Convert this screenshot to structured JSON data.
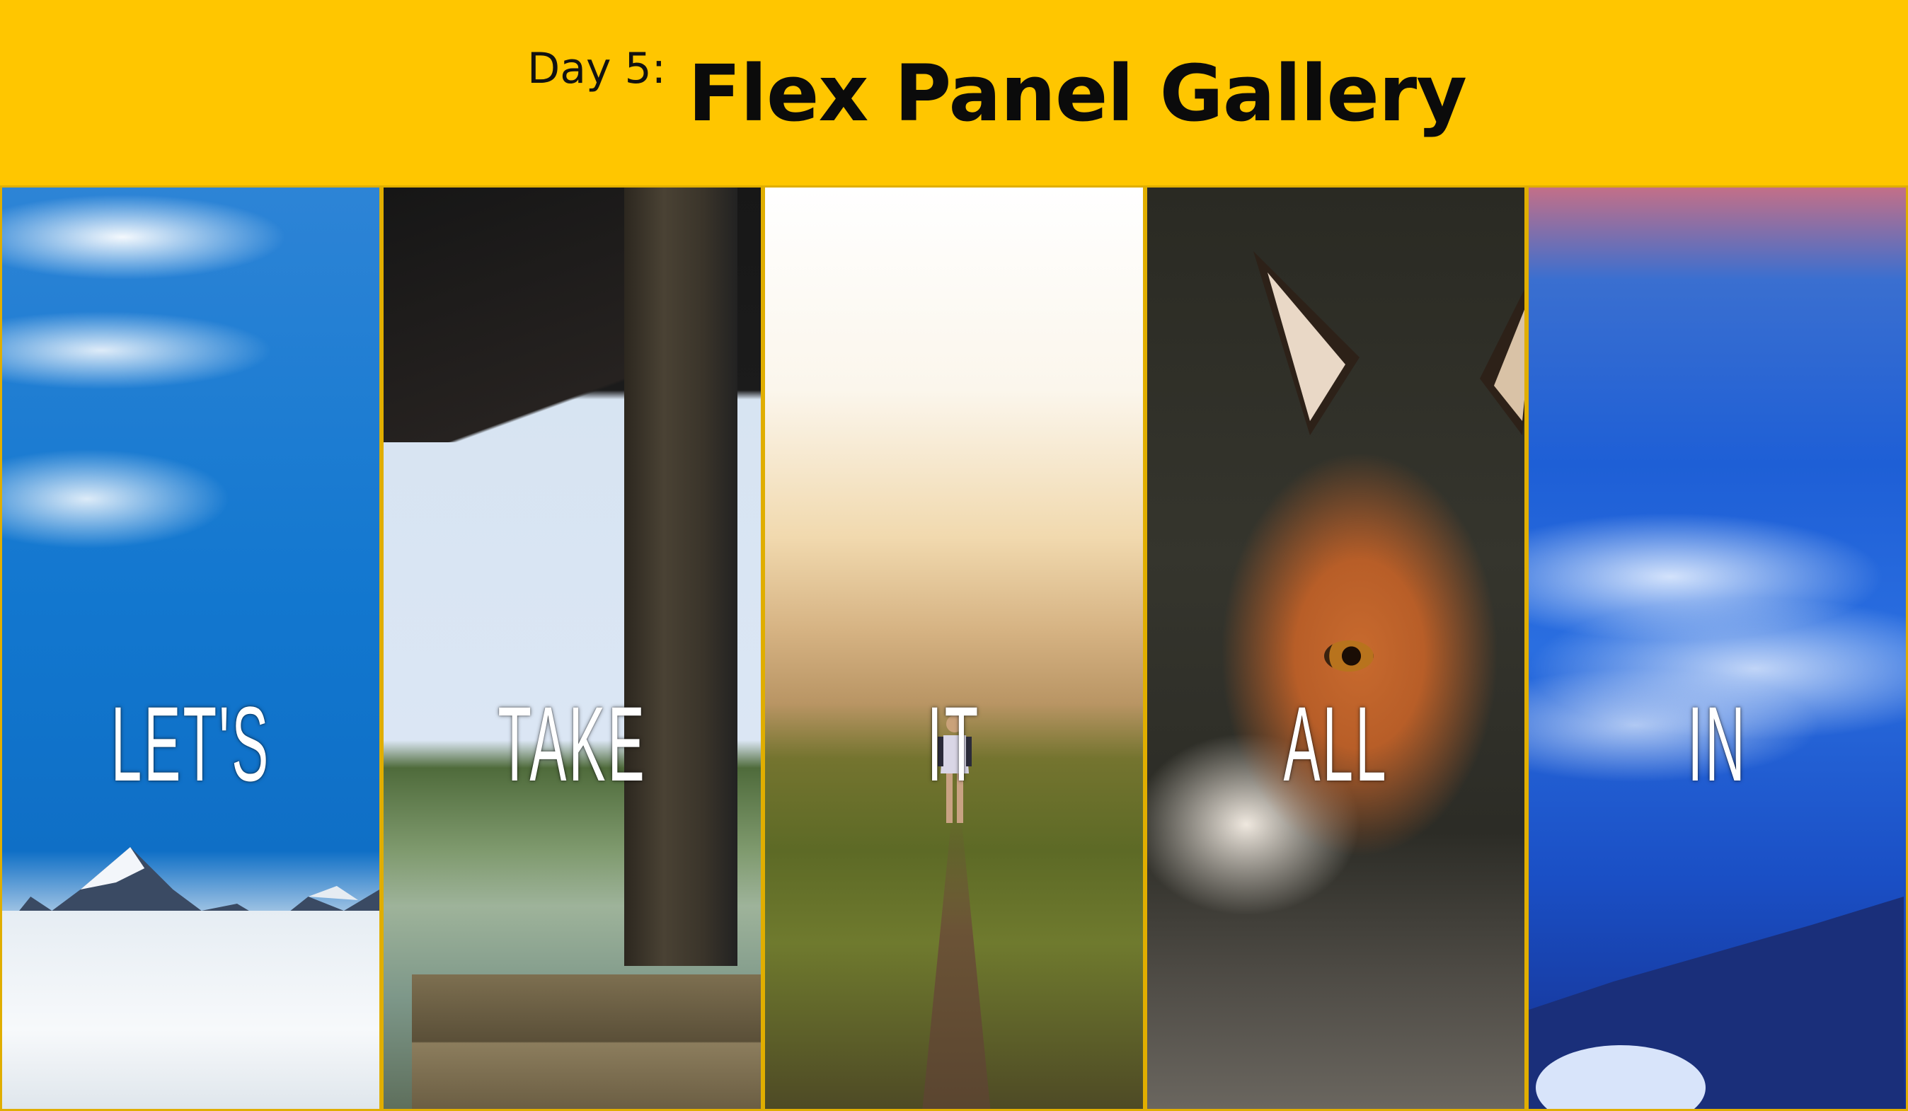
{
  "header": {
    "day_label": "Day 5:",
    "title": "Flex Panel Gallery"
  },
  "panels": [
    {
      "word": "LET'S",
      "scene": "snowy-mountains"
    },
    {
      "word": "TAKE",
      "scene": "wooden-pier"
    },
    {
      "word": "IT",
      "scene": "ridge-hiker"
    },
    {
      "word": "ALL",
      "scene": "red-fox"
    },
    {
      "word": "IN",
      "scene": "sea-of-clouds"
    }
  ],
  "colors": {
    "header_background": "#ffc600",
    "title_text": "#0b0b0b",
    "panel_text": "#ffffff"
  }
}
